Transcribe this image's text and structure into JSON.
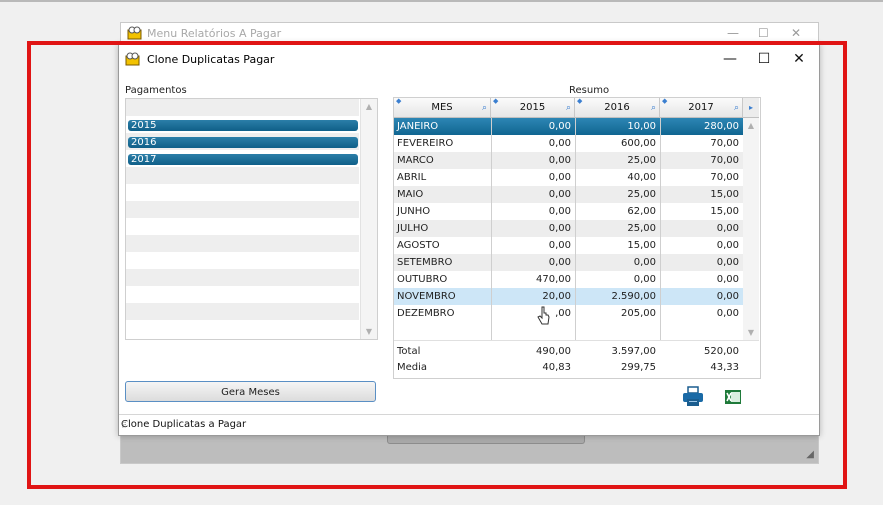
{
  "back_window": {
    "title": "Menu Relatórios A Pagar",
    "minimize": "—",
    "maximize": "☐",
    "close": "✕",
    "resize_grip": "◢"
  },
  "window": {
    "title": "Clone Duplicatas Pagar",
    "minimize": "—",
    "maximize": "☐",
    "close": "✕"
  },
  "pagamentos": {
    "label": "Pagamentos",
    "items": [
      "2015",
      "2016",
      "2017"
    ],
    "scroll_up": "▲",
    "scroll_down": "▼"
  },
  "gera_button": "Gera Meses",
  "resumo": {
    "label": "Resumo",
    "headers": [
      "MES",
      "2015",
      "2016",
      "2017"
    ],
    "sort_glyph": "◆",
    "filter_glyph": "⌕",
    "more_glyph": "▸",
    "rows": [
      {
        "mes": "JANEIRO",
        "v2015": "0,00",
        "v2016": "10,00",
        "v2017": "280,00"
      },
      {
        "mes": "FEVEREIRO",
        "v2015": "0,00",
        "v2016": "600,00",
        "v2017": "70,00"
      },
      {
        "mes": "MARCO",
        "v2015": "0,00",
        "v2016": "25,00",
        "v2017": "70,00"
      },
      {
        "mes": "ABRIL",
        "v2015": "0,00",
        "v2016": "40,00",
        "v2017": "70,00"
      },
      {
        "mes": "MAIO",
        "v2015": "0,00",
        "v2016": "25,00",
        "v2017": "15,00"
      },
      {
        "mes": "JUNHO",
        "v2015": "0,00",
        "v2016": "62,00",
        "v2017": "15,00"
      },
      {
        "mes": "JULHO",
        "v2015": "0,00",
        "v2016": "25,00",
        "v2017": "0,00"
      },
      {
        "mes": "AGOSTO",
        "v2015": "0,00",
        "v2016": "15,00",
        "v2017": "0,00"
      },
      {
        "mes": "SETEMBRO",
        "v2015": "0,00",
        "v2016": "0,00",
        "v2017": "0,00"
      },
      {
        "mes": "OUTUBRO",
        "v2015": "470,00",
        "v2016": "0,00",
        "v2017": "0,00"
      },
      {
        "mes": "NOVEMBRO",
        "v2015": "20,00",
        "v2016": "2.590,00",
        "v2017": "0,00"
      },
      {
        "mes": "DEZEMBRO",
        "v2015": ",00",
        "v2016": "205,00",
        "v2017": "0,00"
      }
    ],
    "total": {
      "label": "Total",
      "v2015": "490,00",
      "v2016": "3.597,00",
      "v2017": "520,00"
    },
    "media": {
      "label": "Media",
      "v2015": "40,83",
      "v2016": "299,75",
      "v2017": "43,33"
    },
    "scroll_up": "▲",
    "scroll_down": "▼"
  },
  "status_bar": {
    "text": "Clone Duplicatas a Pagar",
    "grip": "⠿"
  },
  "colors": {
    "selection": "#106591",
    "highlight_frame": "#e01414",
    "hover_row": "#cde6f7"
  },
  "icons": [
    "printer-icon",
    "excel-icon",
    "app-icon",
    "mouse-cursor-icon"
  ]
}
